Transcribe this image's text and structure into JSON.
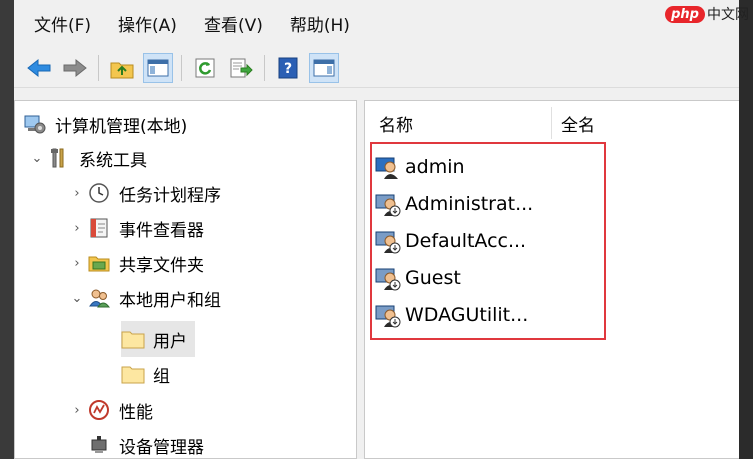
{
  "menu": [
    "文件(F)",
    "操作(A)",
    "查看(V)",
    "帮助(H)"
  ],
  "toolbar": {
    "icons": [
      "back-icon",
      "forward-icon",
      "up-folder-icon",
      "console-tree-icon",
      "refresh-icon",
      "export-list-icon",
      "help-icon",
      "action-pane-icon"
    ]
  },
  "tree": {
    "root": "计算机管理(本地)",
    "system_tools": "系统工具",
    "task_scheduler": "任务计划程序",
    "event_viewer": "事件查看器",
    "shared_folders": "共享文件夹",
    "local_users": "本地用户和组",
    "users": "用户",
    "groups": "组",
    "performance": "性能",
    "device_manager": "设备管理器"
  },
  "list": {
    "col_name": "名称",
    "col_fullname": "全名",
    "users": [
      "admin",
      "Administrat...",
      "DefaultAcc...",
      "Guest",
      "WDAGUtilit..."
    ]
  },
  "watermark": {
    "badge": "php",
    "text": "中文网"
  },
  "colors": {
    "highlight": "#e0383e",
    "selected": "#e6e6e6",
    "accent": "#1e73be"
  }
}
